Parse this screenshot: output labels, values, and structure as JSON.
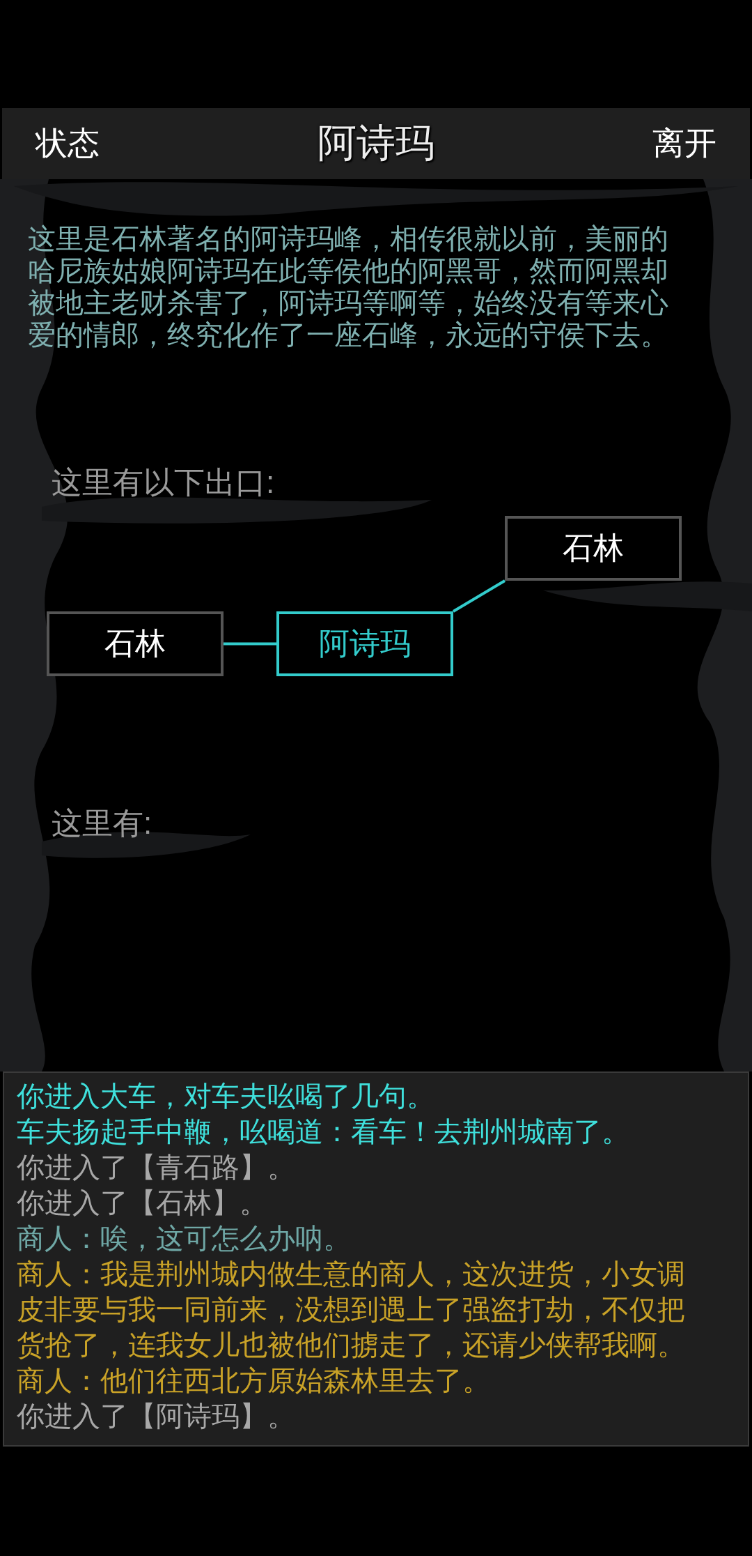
{
  "header": {
    "left_button": "状态",
    "title": "阿诗玛",
    "right_button": "离开"
  },
  "description": "这里是石林著名的阿诗玛峰，相传很就以前，美丽的哈尼族姑娘阿诗玛在此等侯他的阿黑哥，然而阿黑却被地主老财杀害了，阿诗玛等啊等，始终没有等来心爱的情郎，终究化作了一座石峰，永远的守侯下去。",
  "exits_label": "这里有以下出口:",
  "map": {
    "nodes": [
      {
        "label": "石林",
        "kind": "exit"
      },
      {
        "label": "石林",
        "kind": "exit"
      },
      {
        "label": "阿诗玛",
        "kind": "current"
      }
    ]
  },
  "here_label": "这里有:",
  "log": [
    {
      "text": "你进入大车，对车夫吆喝了几句。",
      "color": "#3fe0dc"
    },
    {
      "text": "车夫扬起手中鞭，吆喝道：看车！去荆州城南了。",
      "color": "#3fe0dc"
    },
    {
      "text": "你进入了【青石路】。",
      "color": "#a8a8a8"
    },
    {
      "text": "你进入了【石林】。",
      "color": "#a8a8a8"
    },
    {
      "text": "商人：唉，这可怎么办呐。",
      "color": "#6fa8a6"
    },
    {
      "text": "商人：我是荆州城内做生意的商人，这次进货，小女调皮非要与我一同前来，没想到遇上了强盗打劫，不仅把货抢了，连我女儿也被他们掳走了，还请少侠帮我啊。",
      "color": "#c9a227"
    },
    {
      "text": "商人：他们往西北方原始森林里去了。",
      "color": "#c9a227"
    },
    {
      "text": "你进入了【阿诗玛】。",
      "color": "#a8a8a8"
    }
  ]
}
